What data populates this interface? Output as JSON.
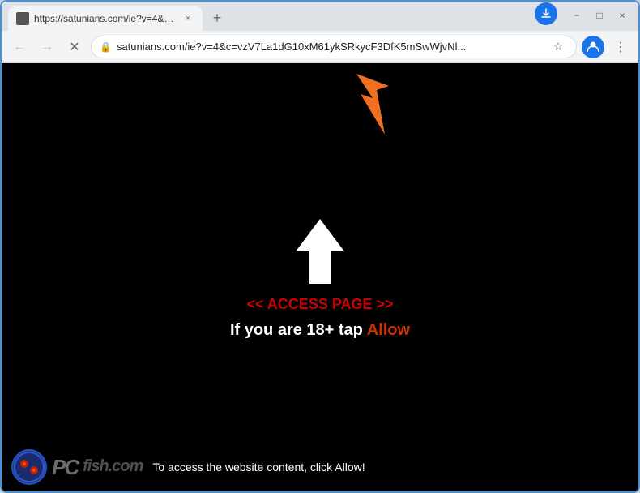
{
  "browser": {
    "tab": {
      "title": "https://satunians.com/ie?v=4&c=...",
      "favicon": "",
      "close_label": "×"
    },
    "new_tab_label": "+",
    "window_controls": {
      "minimize": "−",
      "maximize": "□",
      "close": "×"
    },
    "address_bar": {
      "back_label": "←",
      "forward_label": "→",
      "reload_label": "✕",
      "url": "satunians.com/ie?v=4&c=vzV7La1dG10xM61ykSRkycF3DfK5mSwWjvNl...",
      "lock_icon": "🔒",
      "star_icon": "☆",
      "profile_icon": "👤",
      "menu_icon": "⋮"
    }
  },
  "page": {
    "access_text": "<< ACCESS PAGE >>",
    "main_message_prefix": "If you are 18+ tap ",
    "allow_word": "Allow",
    "arrow_indicator_hint": "↑"
  },
  "banner": {
    "message": "To access the website content, click Allow!",
    "logo_text": "PCfish.com"
  },
  "colors": {
    "arrow_orange": "#f07020",
    "access_red": "#cc0000",
    "allow_red": "#cc3300",
    "bg_black": "#000000",
    "tab_bg": "#dee1e6",
    "active_tab_bg": "#f1f3f4"
  }
}
